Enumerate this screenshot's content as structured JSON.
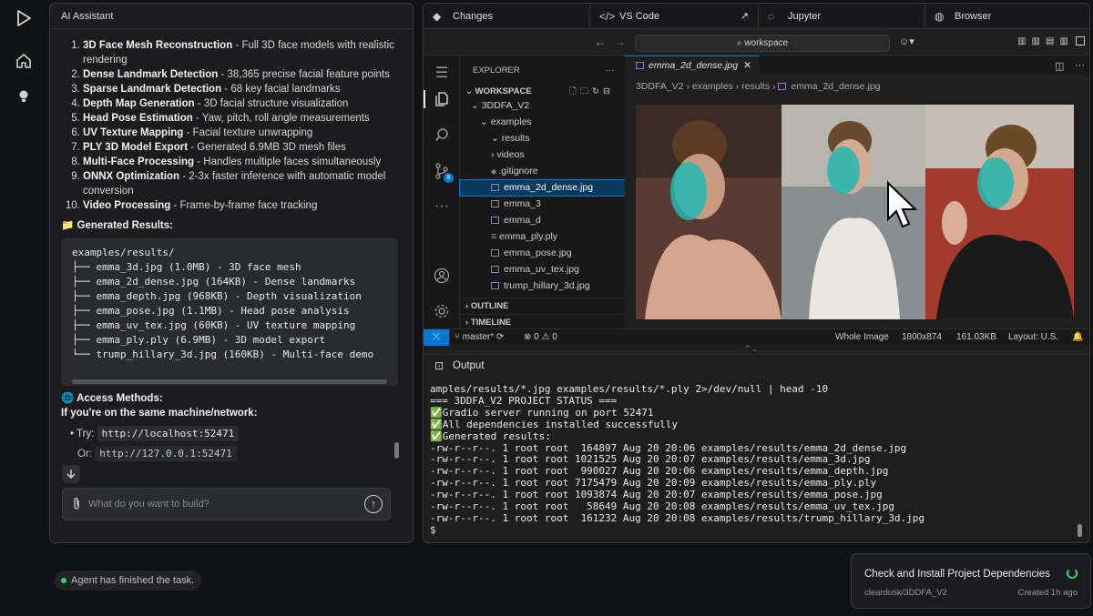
{
  "sidebar_rail": {
    "icons": [
      "logo-play-icon",
      "home-icon",
      "lightbulb-icon"
    ]
  },
  "assistant": {
    "title": "AI Assistant",
    "features": [
      {
        "name": "3D Face Mesh Reconstruction",
        "desc": " - Full 3D face models with realistic rendering"
      },
      {
        "name": "Dense Landmark Detection",
        "desc": " - 38,365 precise facial feature points"
      },
      {
        "name": "Sparse Landmark Detection",
        "desc": " - 68 key facial landmarks"
      },
      {
        "name": "Depth Map Generation",
        "desc": " - 3D facial structure visualization"
      },
      {
        "name": "Head Pose Estimation",
        "desc": " - Yaw, pitch, roll angle measurements"
      },
      {
        "name": "UV Texture Mapping",
        "desc": " - Facial texture unwrapping"
      },
      {
        "name": "PLY 3D Model Export",
        "desc": " - Generated 6.9MB 3D mesh files"
      },
      {
        "name": "Multi-Face Processing",
        "desc": " - Handles multiple faces simultaneously"
      },
      {
        "name": "ONNX Optimization",
        "desc": " - 2-3x faster inference with automatic model conversion"
      },
      {
        "name": "Video Processing",
        "desc": " - Frame-by-frame face tracking"
      }
    ],
    "generated_heading": "📁 Generated Results:",
    "code_lines": [
      "examples/results/",
      "├── emma_3d.jpg (1.0MB) - 3D face mesh",
      "├── emma_2d_dense.jpg (164KB) - Dense landmarks",
      "├── emma_depth.jpg (968KB) - Depth visualization",
      "├── emma_pose.jpg (1.1MB) - Head pose analysis",
      "├── emma_uv_tex.jpg (60KB) - UV texture mapping",
      "├── emma_ply.ply (6.9MB) - 3D model export",
      "└── trump_hillary_3d.jpg (160KB) - Multi-face demo"
    ],
    "access_heading": "🌐 Access Methods:",
    "access_sub": "If you're on the same machine/network:",
    "try_label": "Try:",
    "try_url": "http://localhost:52471",
    "partial_line_label": "Or:",
    "partial_line_url": "http://127.0.0.1:52471",
    "input_placeholder": "What do you want to build?",
    "status": "Agent has finished the task."
  },
  "tabs": [
    {
      "label": "Changes",
      "icon": "diamond-icon"
    },
    {
      "label": "VS Code",
      "icon": "code-icon"
    },
    {
      "label": "Jupyter",
      "icon": "jupyter-icon"
    },
    {
      "label": "Browser",
      "icon": "globe-icon"
    }
  ],
  "vscode": {
    "search": "workspace",
    "explorer_title": "EXPLORER",
    "workspace_label": "WORKSPACE",
    "tree": [
      {
        "label": "3DDFA_V2",
        "indent": 1,
        "type": "folder"
      },
      {
        "label": "examples",
        "indent": 2,
        "type": "folder"
      },
      {
        "label": "results",
        "indent": 3,
        "type": "folder"
      },
      {
        "label": "videos",
        "indent": 3,
        "type": "folder-closed"
      },
      {
        "label": ".gitignore",
        "indent": 3,
        "type": "gitignore"
      },
      {
        "label": "emma_2d_dense.jpg",
        "indent": 3,
        "type": "image",
        "selected": true
      },
      {
        "label": "emma_3",
        "indent": 3,
        "type": "image"
      },
      {
        "label": "emma_d",
        "indent": 3,
        "type": "image"
      },
      {
        "label": "emma_ply.ply",
        "indent": 3,
        "type": "ply"
      },
      {
        "label": "emma_pose.jpg",
        "indent": 3,
        "type": "image"
      },
      {
        "label": "emma_uv_tex.jpg",
        "indent": 3,
        "type": "image"
      },
      {
        "label": "trump_hillary_3d.jpg",
        "indent": 3,
        "type": "image"
      }
    ],
    "outline_label": "OUTLINE",
    "timeline_label": "TIMELINE",
    "editor_tab": "emma_2d_dense.jpg",
    "breadcrumb": [
      "3DDFA_V2",
      "examples",
      "results",
      "emma_2d_dense.jpg"
    ],
    "status": {
      "branch": "master*",
      "problems": "⊗ 0 ⚠ 0",
      "whole": "Whole Image",
      "dims": "1800x874",
      "size": "161.03KB",
      "layout": "Layout: U.S."
    },
    "activity_badge": "8"
  },
  "output": {
    "title": "Output",
    "lines": [
      "amples/results/*.jpg examples/results/*.ply 2>/dev/null | head -10",
      "=== 3DDFA_V2 PROJECT STATUS ===",
      "✅Gradio server running on port 52471",
      "✅All dependencies installed successfully",
      "✅Generated results:",
      "-rw-r--r--. 1 root root  164897 Aug 20 20:06 examples/results/emma_2d_dense.jpg",
      "-rw-r--r--. 1 root root 1021525 Aug 20 20:07 examples/results/emma_3d.jpg",
      "-rw-r--r--. 1 root root  990027 Aug 20 20:06 examples/results/emma_depth.jpg",
      "-rw-r--r--. 1 root root 7175479 Aug 20 20:09 examples/results/emma_ply.ply",
      "-rw-r--r--. 1 root root 1093874 Aug 20 20:07 examples/results/emma_pose.jpg",
      "-rw-r--r--. 1 root root   58649 Aug 20 20:08 examples/results/emma_uv_tex.jpg",
      "-rw-r--r--. 1 root root  161232 Aug 20 20:08 examples/results/trump_hillary_3d.jpg",
      "$"
    ]
  },
  "task_card": {
    "title": "Check and Install Project Dependencies",
    "repo": "cleardusk/3DDFA_V2",
    "created": "Created 1h ago"
  },
  "colors": {
    "accent": "#0078d4",
    "success": "#3ecf6a",
    "mesh": "#22b8b0"
  }
}
